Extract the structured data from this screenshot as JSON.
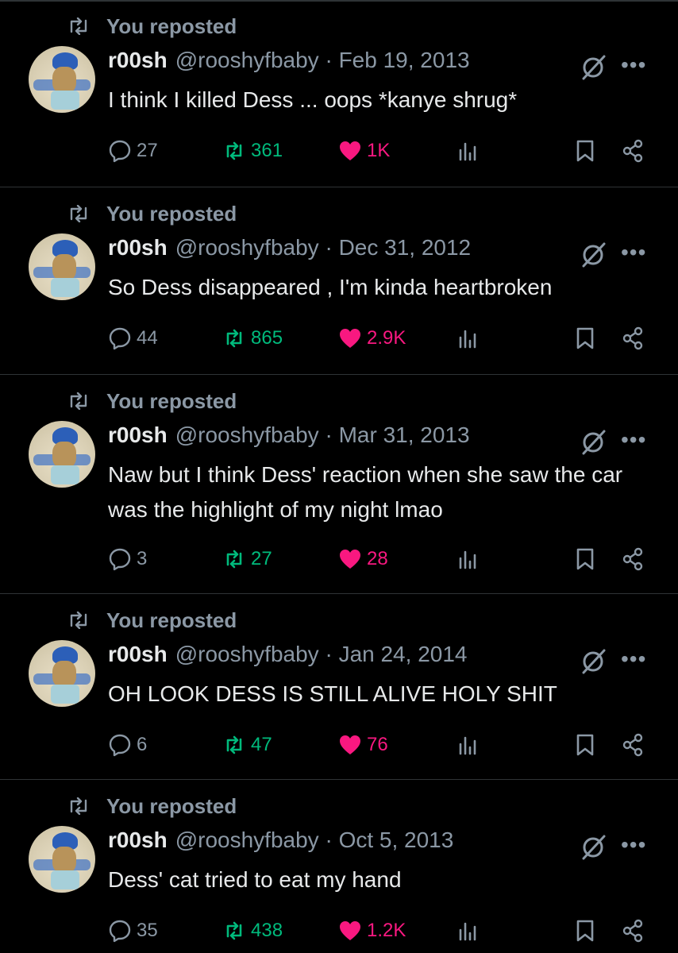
{
  "tweets": [
    {
      "repost_label": "You reposted",
      "name": "r00sh",
      "handle_date": "@rooshyfbaby · Feb 19, 2013",
      "text": "I think I killed Dess ... oops *kanye shrug*",
      "replies": "27",
      "reposts": "361",
      "likes": "1K"
    },
    {
      "repost_label": "You reposted",
      "name": "r00sh",
      "handle_date": "@rooshyfbaby · Dec 31, 2012",
      "text": "So Dess disappeared , I'm kinda heartbroken",
      "replies": "44",
      "reposts": "865",
      "likes": "2.9K"
    },
    {
      "repost_label": "You reposted",
      "name": "r00sh",
      "handle_date": "@rooshyfbaby · Mar 31, 2013",
      "text": "Naw but I think Dess' reaction when she saw the car was the highlight of my night lmao",
      "replies": "3",
      "reposts": "27",
      "likes": "28"
    },
    {
      "repost_label": "You reposted",
      "name": "r00sh",
      "handle_date": "@rooshyfbaby · Jan 24, 2014",
      "text": "OH LOOK DESS IS STILL ALIVE HOLY SHIT",
      "replies": "6",
      "reposts": "47",
      "likes": "76"
    },
    {
      "repost_label": "You reposted",
      "name": "r00sh",
      "handle_date": "@rooshyfbaby · Oct 5, 2013",
      "text": "Dess' cat tried to eat my hand",
      "replies": "35",
      "reposts": "438",
      "likes": "1.2K"
    }
  ],
  "icons": {
    "repost_indicator": "repost-icon",
    "grok": "grok-icon",
    "more": "more-icon",
    "reply": "reply-icon",
    "retweet": "retweet-icon",
    "like": "heart-icon",
    "views": "views-icon",
    "bookmark": "bookmark-icon",
    "share": "share-icon"
  },
  "colors": {
    "background": "#000000",
    "text": "#e7e9ea",
    "muted": "#8b98a5",
    "retweet_green": "#00ba7c",
    "like_pink": "#f91880"
  }
}
